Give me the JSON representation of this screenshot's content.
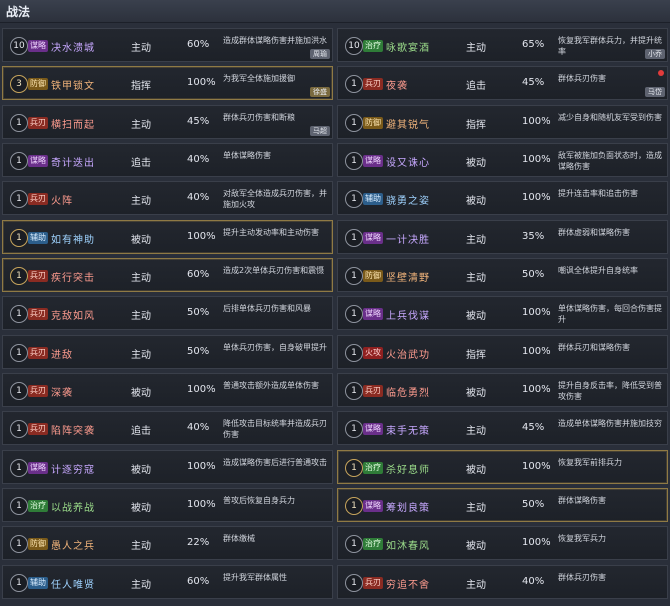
{
  "header": {
    "title": "战法"
  },
  "left": [
    {
      "level": "10",
      "gold": false,
      "type": "谋略",
      "type_class": "t-strat",
      "name": "决水溃城",
      "name_class": "",
      "kind": "主动",
      "rate": "60%",
      "desc": "造成群体谋略伤害并施加洪水",
      "owner": "周瑜"
    },
    {
      "level": "3",
      "gold": true,
      "type": "防御",
      "type_class": "t-def",
      "name": "铁甲锁文",
      "name_class": "c-orange",
      "kind": "指挥",
      "rate": "100%",
      "desc": "为我军全体施加援御",
      "owner": "徐盛"
    },
    {
      "level": "1",
      "gold": false,
      "type": "兵刃",
      "type_class": "t-troop",
      "name": "横扫而起",
      "name_class": "c-red",
      "kind": "主动",
      "rate": "45%",
      "desc": "群体兵刃伤害和断粮",
      "owner": "马超"
    },
    {
      "level": "1",
      "gold": false,
      "type": "谋略",
      "type_class": "t-strat",
      "name": "奇计迭出",
      "name_class": "",
      "kind": "追击",
      "rate": "40%",
      "desc": "单体谋略伤害",
      "owner": ""
    },
    {
      "level": "1",
      "gold": false,
      "type": "兵刃",
      "type_class": "t-troop",
      "name": "火阵",
      "name_class": "c-red",
      "kind": "主动",
      "rate": "40%",
      "desc": "对敌军全体造成兵刃伤害，并施加火攻",
      "owner": ""
    },
    {
      "level": "1",
      "gold": true,
      "type": "辅助",
      "type_class": "t-aux",
      "name": "如有神助",
      "name_class": "c-blue",
      "kind": "被动",
      "rate": "100%",
      "desc": "提升主动发动率和主动伤害",
      "owner": ""
    },
    {
      "level": "1",
      "gold": true,
      "type": "兵刃",
      "type_class": "t-troop",
      "name": "疾行突击",
      "name_class": "c-red",
      "kind": "主动",
      "rate": "60%",
      "desc": "造成2次单体兵刃伤害和震慑",
      "owner": ""
    },
    {
      "level": "1",
      "gold": false,
      "type": "兵刃",
      "type_class": "t-troop",
      "name": "克敌如风",
      "name_class": "c-red",
      "kind": "主动",
      "rate": "50%",
      "desc": "后排单体兵刃伤害和风暴",
      "owner": ""
    },
    {
      "level": "1",
      "gold": false,
      "type": "兵刃",
      "type_class": "t-troop",
      "name": "进敌",
      "name_class": "c-red",
      "kind": "主动",
      "rate": "50%",
      "desc": "单体兵刃伤害，自身破甲提升",
      "owner": ""
    },
    {
      "level": "1",
      "gold": false,
      "type": "兵刃",
      "type_class": "t-troop",
      "name": "深袭",
      "name_class": "c-red",
      "kind": "被动",
      "rate": "100%",
      "desc": "普通攻击额外造成单体伤害",
      "owner": ""
    },
    {
      "level": "1",
      "gold": false,
      "type": "兵刃",
      "type_class": "t-troop",
      "name": "陷阵突袭",
      "name_class": "c-red",
      "kind": "追击",
      "rate": "40%",
      "desc": "降低攻击目标统率并造成兵刃伤害",
      "owner": ""
    },
    {
      "level": "1",
      "gold": false,
      "type": "谋略",
      "type_class": "t-strat",
      "name": "计逐穷寇",
      "name_class": "",
      "kind": "被动",
      "rate": "100%",
      "desc": "造成谋略伤害后进行普通攻击",
      "owner": ""
    },
    {
      "level": "1",
      "gold": false,
      "type": "治疗",
      "type_class": "t-heal",
      "name": "以战养战",
      "name_class": "c-green",
      "kind": "被动",
      "rate": "100%",
      "desc": "普攻后恢复自身兵力",
      "owner": ""
    },
    {
      "level": "1",
      "gold": false,
      "type": "防御",
      "type_class": "t-def",
      "name": "愚人之兵",
      "name_class": "c-orange",
      "kind": "主动",
      "rate": "22%",
      "desc": "群体缴械",
      "owner": ""
    },
    {
      "level": "1",
      "gold": false,
      "type": "辅助",
      "type_class": "t-aux",
      "name": "任人唯贤",
      "name_class": "c-blue",
      "kind": "主动",
      "rate": "60%",
      "desc": "提升我军群体属性",
      "owner": ""
    }
  ],
  "right": [
    {
      "level": "10",
      "gold": false,
      "type": "治疗",
      "type_class": "t-heal",
      "name": "咏歌宴酒",
      "name_class": "c-green",
      "kind": "主动",
      "rate": "65%",
      "desc": "恢复我军群体兵力，并提升统率",
      "owner": "小乔",
      "dot": false
    },
    {
      "level": "1",
      "gold": false,
      "type": "兵刃",
      "type_class": "t-troop",
      "name": "夜袭",
      "name_class": "c-red",
      "kind": "追击",
      "rate": "45%",
      "desc": "群体兵刃伤害",
      "owner": "马岱",
      "dot": true
    },
    {
      "level": "1",
      "gold": false,
      "type": "防御",
      "type_class": "t-def",
      "name": "避其锐气",
      "name_class": "c-orange",
      "kind": "指挥",
      "rate": "100%",
      "desc": "减少自身和随机友军受到伤害",
      "owner": "",
      "dot": false
    },
    {
      "level": "1",
      "gold": false,
      "type": "谋略",
      "type_class": "t-strat",
      "name": "设又诛心",
      "name_class": "",
      "kind": "被动",
      "rate": "100%",
      "desc": "敌军被施加负面状态时，造成谋略伤害",
      "owner": "",
      "dot": false
    },
    {
      "level": "1",
      "gold": false,
      "type": "辅助",
      "type_class": "t-aux",
      "name": "骁勇之姿",
      "name_class": "c-blue",
      "kind": "被动",
      "rate": "100%",
      "desc": "提升连击率和追击伤害",
      "owner": "",
      "dot": false
    },
    {
      "level": "1",
      "gold": false,
      "type": "谋略",
      "type_class": "t-strat",
      "name": "一计决胜",
      "name_class": "",
      "kind": "主动",
      "rate": "35%",
      "desc": "群体虚弱和谋略伤害",
      "owner": "",
      "dot": false
    },
    {
      "level": "1",
      "gold": false,
      "type": "防御",
      "type_class": "t-def",
      "name": "坚壁清野",
      "name_class": "c-orange",
      "kind": "主动",
      "rate": "50%",
      "desc": "嘲讽全体提升自身统率",
      "owner": "",
      "dot": false
    },
    {
      "level": "1",
      "gold": false,
      "type": "谋略",
      "type_class": "t-strat",
      "name": "上兵伐谋",
      "name_class": "",
      "kind": "被动",
      "rate": "100%",
      "desc": "单体谋略伤害，每回合伤害提升",
      "owner": "",
      "dot": false
    },
    {
      "level": "1",
      "gold": false,
      "type": "火攻",
      "type_class": "t-fire",
      "name": "火治武功",
      "name_class": "c-red",
      "kind": "指挥",
      "rate": "100%",
      "desc": "群体兵刃和谋略伤害",
      "owner": "",
      "dot": false
    },
    {
      "level": "1",
      "gold": false,
      "type": "兵刃",
      "type_class": "t-troop",
      "name": "临危勇烈",
      "name_class": "c-red",
      "kind": "被动",
      "rate": "100%",
      "desc": "提升自身反击率，降低受到普攻伤害",
      "owner": "",
      "dot": false
    },
    {
      "level": "1",
      "gold": false,
      "type": "谋略",
      "type_class": "t-strat",
      "name": "束手无策",
      "name_class": "",
      "kind": "主动",
      "rate": "45%",
      "desc": "造成单体谋略伤害并施加技穷",
      "owner": "",
      "dot": false
    },
    {
      "level": "1",
      "gold": true,
      "type": "治疗",
      "type_class": "t-heal",
      "name": "杀好息师",
      "name_class": "c-green",
      "kind": "被动",
      "rate": "100%",
      "desc": "恢复我军前排兵力",
      "owner": "",
      "dot": false
    },
    {
      "level": "1",
      "gold": true,
      "type": "谋略",
      "type_class": "t-strat",
      "name": "筹划良策",
      "name_class": "",
      "kind": "主动",
      "rate": "50%",
      "desc": "群体谋略伤害",
      "owner": "",
      "dot": false
    },
    {
      "level": "1",
      "gold": false,
      "type": "治疗",
      "type_class": "t-heal",
      "name": "如沐春风",
      "name_class": "c-green",
      "kind": "被动",
      "rate": "100%",
      "desc": "恢复我军兵力",
      "owner": "",
      "dot": false
    },
    {
      "level": "1",
      "gold": false,
      "type": "兵刃",
      "type_class": "t-troop",
      "name": "穷追不舍",
      "name_class": "c-red",
      "kind": "主动",
      "rate": "40%",
      "desc": "群体兵刃伤害",
      "owner": "",
      "dot": false
    }
  ]
}
